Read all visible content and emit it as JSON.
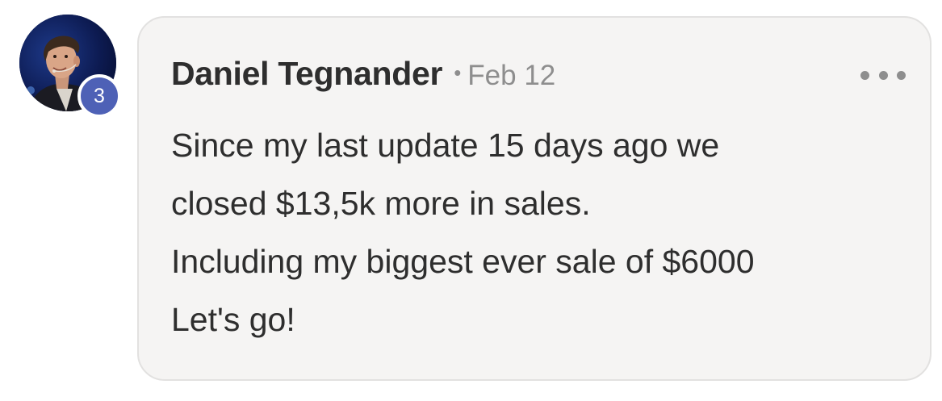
{
  "comment": {
    "author": {
      "name": "Daniel Tegnander",
      "level": "3"
    },
    "separator": "•",
    "date": "Feb 12",
    "lines": [
      "Since my last update 15 days ago we",
      "closed $13,5k more in sales.",
      "Including my biggest ever sale of $6000",
      "Let's go!"
    ],
    "colors": {
      "card_background": "#f5f4f3",
      "badge": "#4e61b6",
      "name_text": "#2e2e2e",
      "meta_text": "#8e8e8e"
    },
    "icons": {
      "more": "more-horizontal-icon"
    }
  }
}
